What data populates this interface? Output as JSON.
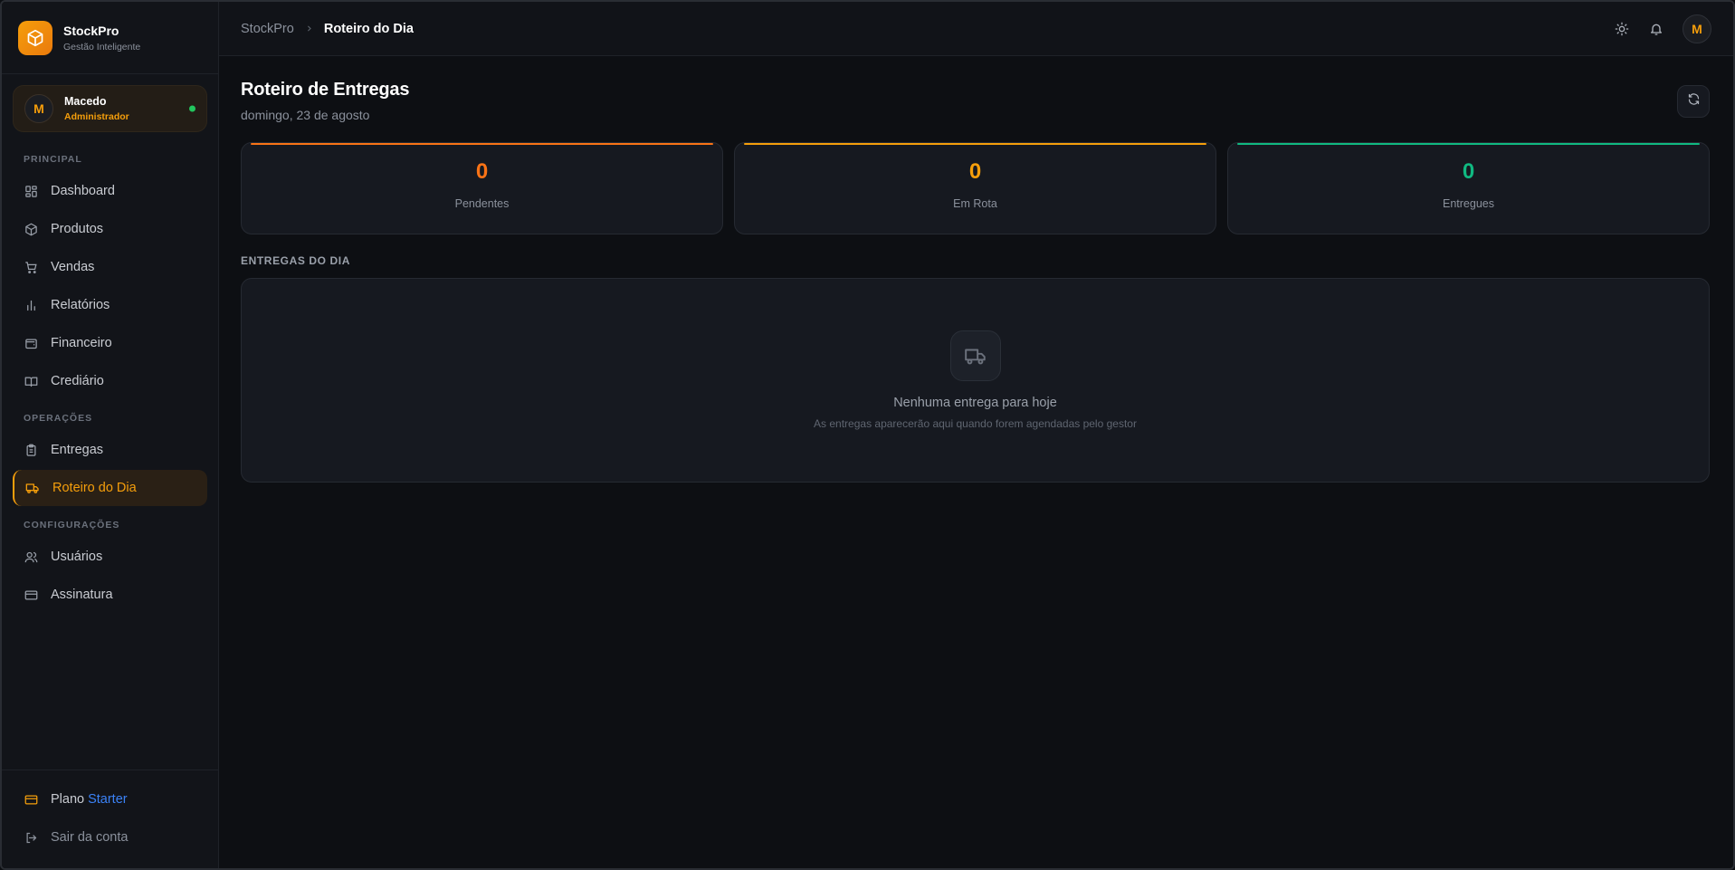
{
  "brand": {
    "name": "StockPro",
    "subtitle": "Gestão Inteligente",
    "logo_icon": "cube-icon"
  },
  "user": {
    "initial": "M",
    "name": "Macedo",
    "role": "Administrador",
    "status": "online"
  },
  "sidebar": {
    "sections": [
      {
        "label": "PRINCIPAL",
        "items": [
          {
            "label": "Dashboard",
            "icon": "grid-icon"
          },
          {
            "label": "Produtos",
            "icon": "box-icon"
          },
          {
            "label": "Vendas",
            "icon": "cart-icon"
          },
          {
            "label": "Relatórios",
            "icon": "bar-chart-icon"
          },
          {
            "label": "Financeiro",
            "icon": "wallet-icon"
          },
          {
            "label": "Crediário",
            "icon": "book-icon"
          }
        ]
      },
      {
        "label": "OPERAÇÕES",
        "items": [
          {
            "label": "Entregas",
            "icon": "clipboard-icon"
          },
          {
            "label": "Roteiro do Dia",
            "icon": "truck-icon",
            "active": true
          }
        ]
      },
      {
        "label": "CONFIGURAÇÕES",
        "items": [
          {
            "label": "Usuários",
            "icon": "users-icon"
          },
          {
            "label": "Assinatura",
            "icon": "credit-card-icon"
          }
        ]
      }
    ],
    "footer": {
      "plan_prefix": "Plano",
      "plan_name": "Starter",
      "logout": "Sair da conta"
    }
  },
  "topbar": {
    "breadcrumb_root": "StockPro",
    "breadcrumb_current": "Roteiro do Dia",
    "avatar_initial": "M"
  },
  "page": {
    "title": "Roteiro de Entregas",
    "date": "domingo, 23 de agosto"
  },
  "stats": [
    {
      "value": "0",
      "label": "Pendentes",
      "color": "#f97316"
    },
    {
      "value": "0",
      "label": "Em Rota",
      "color": "#f59e0b"
    },
    {
      "value": "0",
      "label": "Entregues",
      "color": "#10b981"
    }
  ],
  "deliveries": {
    "section_title": "ENTREGAS DO DIA",
    "empty_title": "Nenhuma entrega para hoje",
    "empty_subtitle": "As entregas aparecerão aqui quando forem agendadas pelo gestor"
  },
  "colors": {
    "accent": "#f59e0b",
    "plan_accent": "#3b82f6",
    "online": "#22c55e"
  }
}
